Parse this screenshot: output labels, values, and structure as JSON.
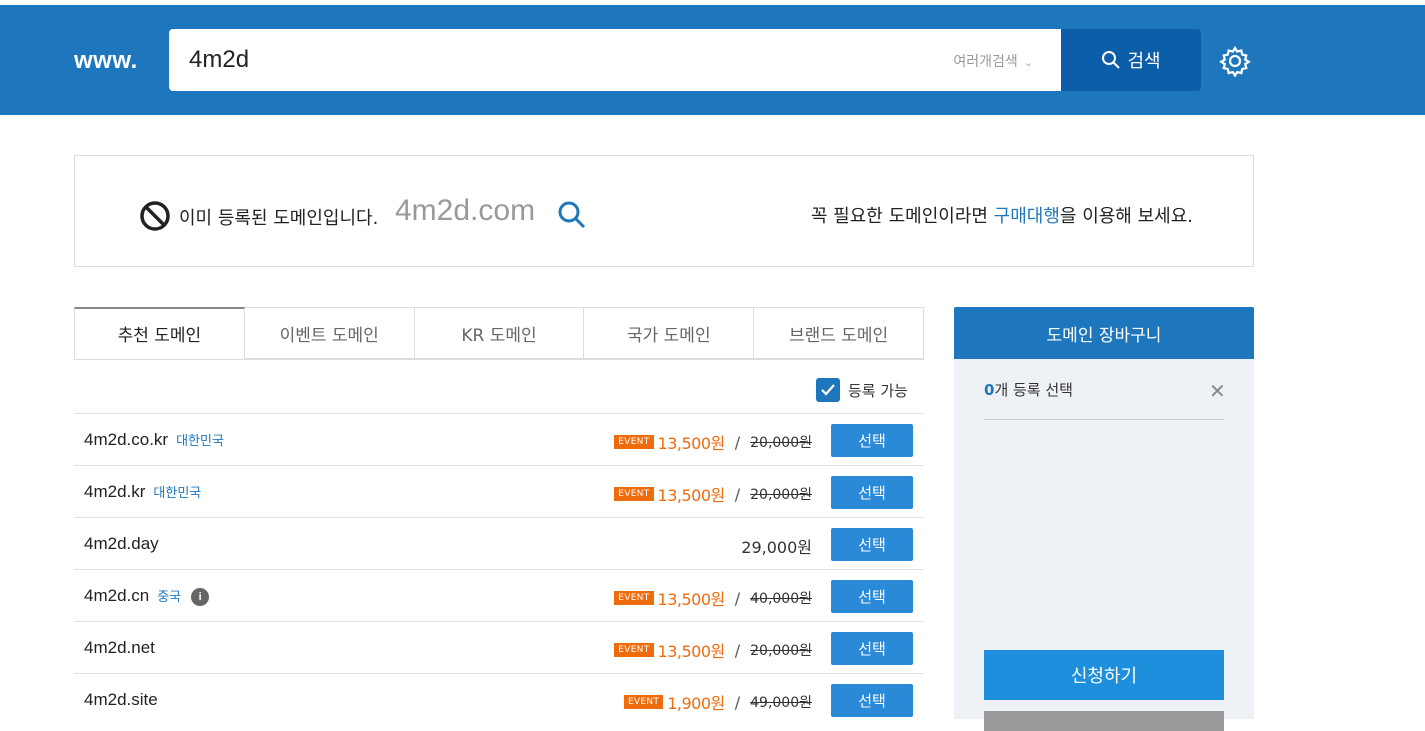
{
  "header": {
    "prefix": "www.",
    "search_value": "4m2d",
    "multi_search_label": "여러개검색",
    "search_button_label": "검색"
  },
  "notice": {
    "status_text": "이미 등록된 도메인입니다.",
    "domain": "4m2d.com",
    "right_prefix": "꼭 필요한 도메인이라면 ",
    "right_link": "구매대행",
    "right_suffix": "을 이용해 보세요."
  },
  "tabs": [
    {
      "label": "추천 도메인",
      "active": true
    },
    {
      "label": "이벤트 도메인",
      "active": false
    },
    {
      "label": "KR 도메인",
      "active": false
    },
    {
      "label": "국가 도메인",
      "active": false
    },
    {
      "label": "브랜드 도메인",
      "active": false
    }
  ],
  "filter": {
    "label": "등록 가능",
    "checked": true
  },
  "rows": [
    {
      "domain": "4m2d.co.kr",
      "country": "대한민국",
      "event": "EVENT",
      "price": "13,500원",
      "original": "20,000원",
      "button": "선택"
    },
    {
      "domain": "4m2d.kr",
      "country": "대한민국",
      "event": "EVENT",
      "price": "13,500원",
      "original": "20,000원",
      "button": "선택"
    },
    {
      "domain": "4m2d.day",
      "price": "29,000원",
      "button": "선택"
    },
    {
      "domain": "4m2d.cn",
      "country": "중국",
      "info": "i",
      "event": "EVENT",
      "price": "13,500원",
      "original": "40,000원",
      "button": "선택"
    },
    {
      "domain": "4m2d.net",
      "event": "EVENT",
      "price": "13,500원",
      "original": "20,000원",
      "button": "선택"
    },
    {
      "domain": "4m2d.site",
      "event": "EVENT",
      "price": "1,900원",
      "original": "49,000원",
      "button": "선택"
    }
  ],
  "cart": {
    "title": "도메인 장바구니",
    "count": "0",
    "count_suffix": "개 등록 선택",
    "apply_label": "신청하기"
  },
  "colors": {
    "brand": "#1e77bd",
    "event": "#ee6c0c",
    "button": "#2a8ad7"
  }
}
